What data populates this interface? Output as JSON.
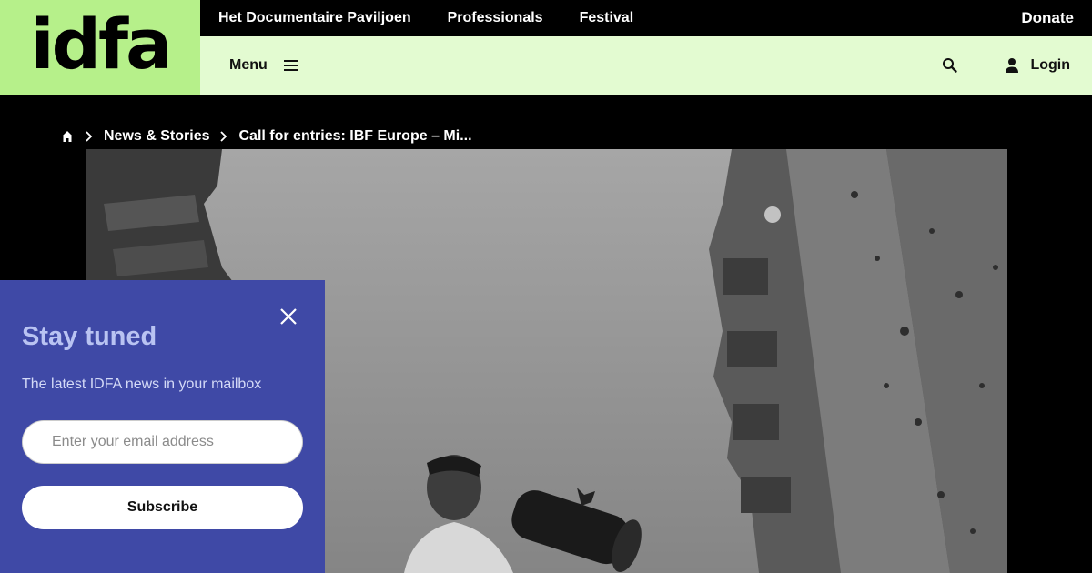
{
  "logo": {
    "text": "idfa"
  },
  "topbar": {
    "links": [
      "Het Documentaire Paviljoen",
      "Professionals",
      "Festival"
    ],
    "donate_label": "Donate"
  },
  "subbar": {
    "menu_label": "Menu",
    "login_label": "Login"
  },
  "breadcrumb": {
    "items": [
      "News & Stories",
      "Call for entries: IBF Europe – Mi..."
    ]
  },
  "hero": {
    "description": "Black and white film still: young man carrying a loudspeaker in front of war-damaged apartment blocks"
  },
  "newsletter": {
    "title": "Stay tuned",
    "subtitle": "The latest IDFA news in your mailbox",
    "email_placeholder": "Enter your email address",
    "subscribe_label": "Subscribe"
  },
  "colors": {
    "logo_bg": "#b6f08a",
    "subbar_bg": "#e3fbd1",
    "newsletter_bg": "#3f49a6",
    "newsletter_title": "#b9c3f2"
  },
  "icons": [
    "home-icon",
    "chevron-right-icon",
    "hamburger-icon",
    "search-icon",
    "user-icon",
    "close-icon"
  ]
}
